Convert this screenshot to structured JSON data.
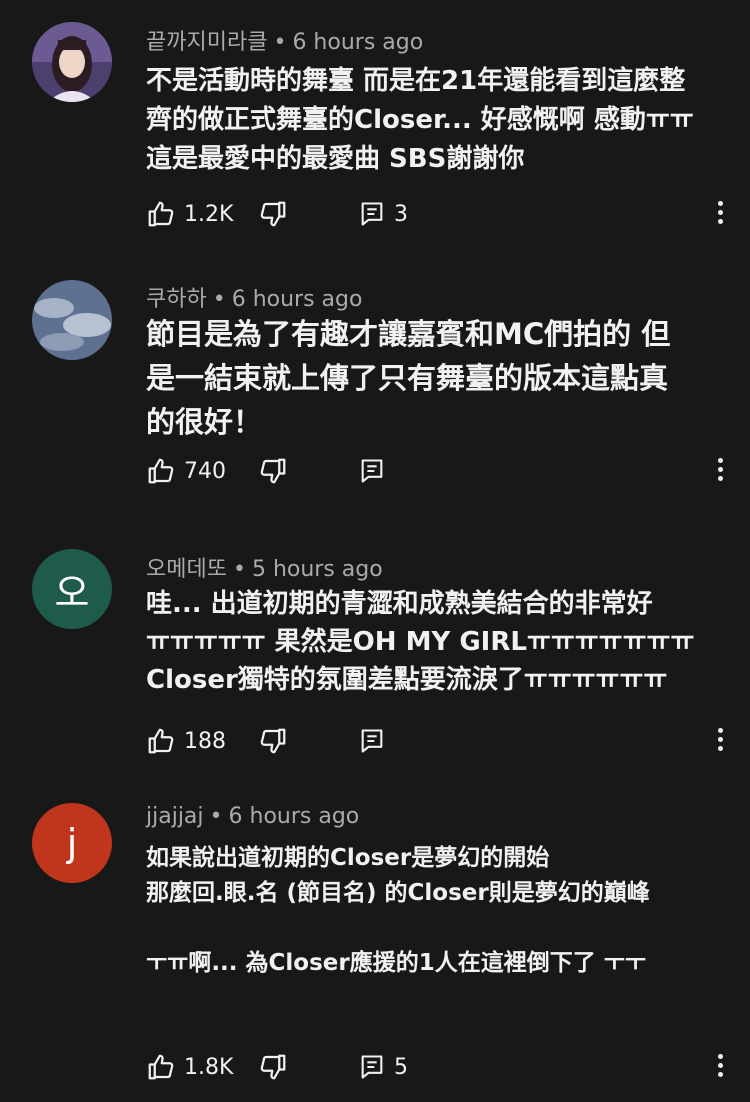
{
  "comments": [
    {
      "author": "끝까지미라클",
      "time": "6 hours ago",
      "lines": [
        "不是活動時的舞臺 而是在21年還能看到這麼整",
        "齊的做正式舞臺的Closer... 好感慨啊 感動ㅠㅠ",
        "這是最愛中的最愛曲 SBS謝謝你"
      ],
      "likes": "1.2K",
      "replies": "3",
      "avatar_color": "#5a4a7a"
    },
    {
      "author": "쿠하하",
      "time": "6 hours ago",
      "lines": [
        "節目是為了有趣才讓嘉賓和MC們拍的 但",
        "是一結束就上傳了只有舞臺的版本這點真",
        "的很好！"
      ],
      "likes": "740",
      "replies": "",
      "avatar_color": "#6e7f99"
    },
    {
      "author": "오메데또",
      "time": "5 hours ago",
      "avatar_letter": "오",
      "lines": [
        "哇... 出道初期的青澀和成熟美結合的非常好",
        "ㅠㅠㅠㅠㅠ 果然是OH MY GIRLㅠㅠㅠㅠㅠㅠㅠ",
        "Closer獨特的氛圍差點要流淚了ㅠㅠㅠㅠㅠㅠ"
      ],
      "likes": "188",
      "replies": "",
      "avatar_color": "#1e5b4a"
    },
    {
      "author": "jjajjaj",
      "time": "6 hours ago",
      "avatar_letter": "j",
      "lines": [
        "如果說出道初期的Closer是夢幻的開始",
        "那麼回.眼.名 (節目名) 的Closer則是夢幻的巔峰",
        "",
        "ㅜㅠ啊... 為Closer應援的1人在這裡倒下了 ㅜㅜ"
      ],
      "likes": "1.8K",
      "replies": "5",
      "avatar_color": "#c0361c"
    }
  ],
  "icons": {
    "like": "thumbs-up-icon",
    "dislike": "thumbs-down-icon",
    "reply": "reply-icon",
    "more": "more-vertical-icon"
  }
}
